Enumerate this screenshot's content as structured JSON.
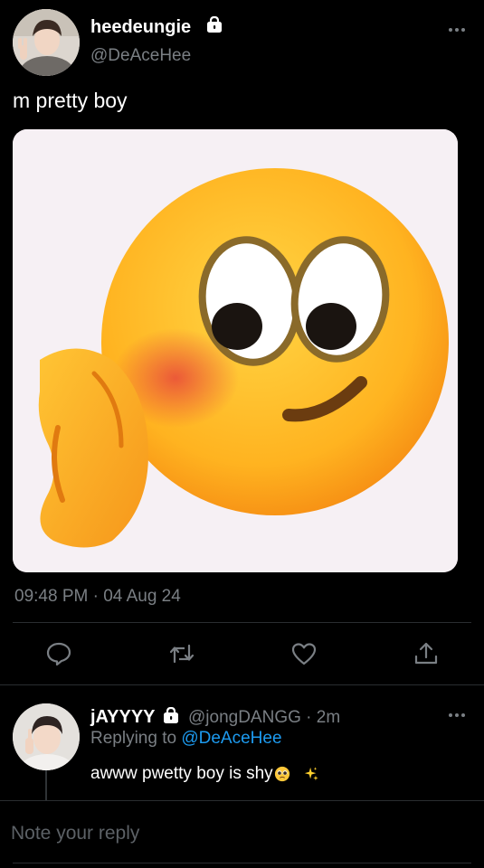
{
  "tweet": {
    "display_name": "heedeungie",
    "handle": "@DeAceHee",
    "text": "m pretty boy",
    "timestamp": "09:48 PM · 04 Aug 24",
    "protected": true
  },
  "actions": {
    "reply_icon": "reply-icon",
    "retweet_icon": "retweet-icon",
    "like_icon": "heart-icon",
    "share_icon": "share-icon"
  },
  "reply": {
    "display_name": "jAYYYY",
    "handle_time": "@jongDANGG · 2m",
    "replying_prefix": "Replying to ",
    "replying_to": "@DeAceHee",
    "text": "awww pwetty boy is shy",
    "emojis": [
      "pleading-face-emoji",
      "sparkles-emoji"
    ],
    "protected": true
  },
  "compose": {
    "placeholder": "Note your reply"
  },
  "colors": {
    "background": "#000000",
    "text": "#ffffff",
    "secondary": "#7a7f84",
    "link": "#1d9bf0",
    "divider": "#2a2d30"
  }
}
